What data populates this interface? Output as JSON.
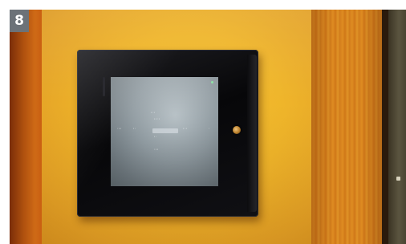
{
  "figure": {
    "badge_number": "8"
  },
  "touch_panel": {
    "brand_lettering": "",
    "screen_menu_items": [
      "",
      "",
      "",
      "",
      ""
    ],
    "selected_item": ""
  },
  "colors": {
    "wall": "#efb52a",
    "wood": "#d6801d",
    "bezel": "#070709",
    "badge": "#6c7278"
  }
}
